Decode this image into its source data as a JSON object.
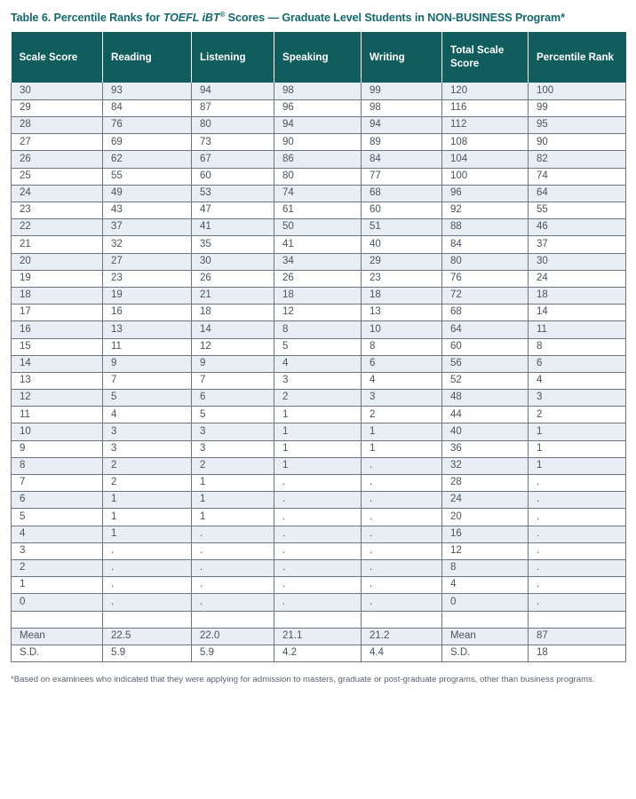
{
  "title": {
    "prefix": "Table 6.  Percentile Ranks for ",
    "italic_part": "TOEFL iBT",
    "registered_mark": "®",
    "suffix": " Scores — Graduate Level Students in NON-BUSINESS Program*"
  },
  "table": {
    "headers": [
      "Scale Score",
      "Reading",
      "Listening",
      "Speaking",
      "Writing",
      "Total Scale Score",
      "Percentile Rank"
    ],
    "rows": [
      [
        "30",
        "93",
        "94",
        "98",
        "99",
        "120",
        "100"
      ],
      [
        "29",
        "84",
        "87",
        "96",
        "98",
        "116",
        "99"
      ],
      [
        "28",
        "76",
        "80",
        "94",
        "94",
        "112",
        "95"
      ],
      [
        "27",
        "69",
        "73",
        "90",
        "89",
        "108",
        "90"
      ],
      [
        "26",
        "62",
        "67",
        "86",
        "84",
        "104",
        "82"
      ],
      [
        "25",
        "55",
        "60",
        "80",
        "77",
        "100",
        "74"
      ],
      [
        "24",
        "49",
        "53",
        "74",
        "68",
        "96",
        "64"
      ],
      [
        "23",
        "43",
        "47",
        "61",
        "60",
        "92",
        "55"
      ],
      [
        "22",
        "37",
        "41",
        "50",
        "51",
        "88",
        "46"
      ],
      [
        "21",
        "32",
        "35",
        "41",
        "40",
        "84",
        "37"
      ],
      [
        "20",
        "27",
        "30",
        "34",
        "29",
        "80",
        "30"
      ],
      [
        "19",
        "23",
        "26",
        "26",
        "23",
        "76",
        "24"
      ],
      [
        "18",
        "19",
        "21",
        "18",
        "18",
        "72",
        "18"
      ],
      [
        "17",
        "16",
        "18",
        "12",
        "13",
        "68",
        "14"
      ],
      [
        "16",
        "13",
        "14",
        "8",
        "10",
        "64",
        "11"
      ],
      [
        "15",
        "11",
        "12",
        "5",
        "8",
        "60",
        "8"
      ],
      [
        "14",
        "9",
        "9",
        "4",
        "6",
        "56",
        "6"
      ],
      [
        "13",
        "7",
        "7",
        "3",
        "4",
        "52",
        "4"
      ],
      [
        "12",
        "5",
        "6",
        "2",
        "3",
        "48",
        "3"
      ],
      [
        "11",
        "4",
        "5",
        "1",
        "2",
        "44",
        "2"
      ],
      [
        "10",
        "3",
        "3",
        "1",
        "1",
        "40",
        "1"
      ],
      [
        "9",
        "3",
        "3",
        "1",
        "1",
        "36",
        "1"
      ],
      [
        "8",
        "2",
        "2",
        "1",
        ".",
        "32",
        "1"
      ],
      [
        "7",
        "2",
        "1",
        ".",
        ".",
        "28",
        "."
      ],
      [
        "6",
        "1",
        "1",
        ".",
        ".",
        "24",
        "."
      ],
      [
        "5",
        "1",
        "1",
        ".",
        ".",
        "20",
        "."
      ],
      [
        "4",
        "1",
        ".",
        ".",
        ".",
        "16",
        "."
      ],
      [
        "3",
        ".",
        ".",
        ".",
        ".",
        "12",
        "."
      ],
      [
        "2",
        ".",
        ".",
        ".",
        ".",
        "8",
        "."
      ],
      [
        "1",
        ".",
        ".",
        ".",
        ".",
        "4",
        "."
      ],
      [
        "0",
        ".",
        ".",
        ".",
        ".",
        "0",
        "."
      ]
    ],
    "spacer_row": [
      "",
      "",
      "",
      "",
      "",
      "",
      ""
    ],
    "summary_rows": [
      [
        "Mean",
        "22.5",
        "22.0",
        "21.1",
        "21.2",
        "Mean",
        "87"
      ],
      [
        "S.D.",
        "5.9",
        "5.9",
        "4.2",
        "4.4",
        "S.D.",
        "18"
      ]
    ]
  },
  "footnote": "*Based on examinees who indicated that they were applying for admission to masters, graduate or post-graduate programs, other than business programs.",
  "colors": {
    "header_bg": "#115c5c",
    "title_text": "#14696d",
    "shaded_row_bg": "#e9eef4",
    "body_text": "#4a5360",
    "border": "#6d7581"
  }
}
